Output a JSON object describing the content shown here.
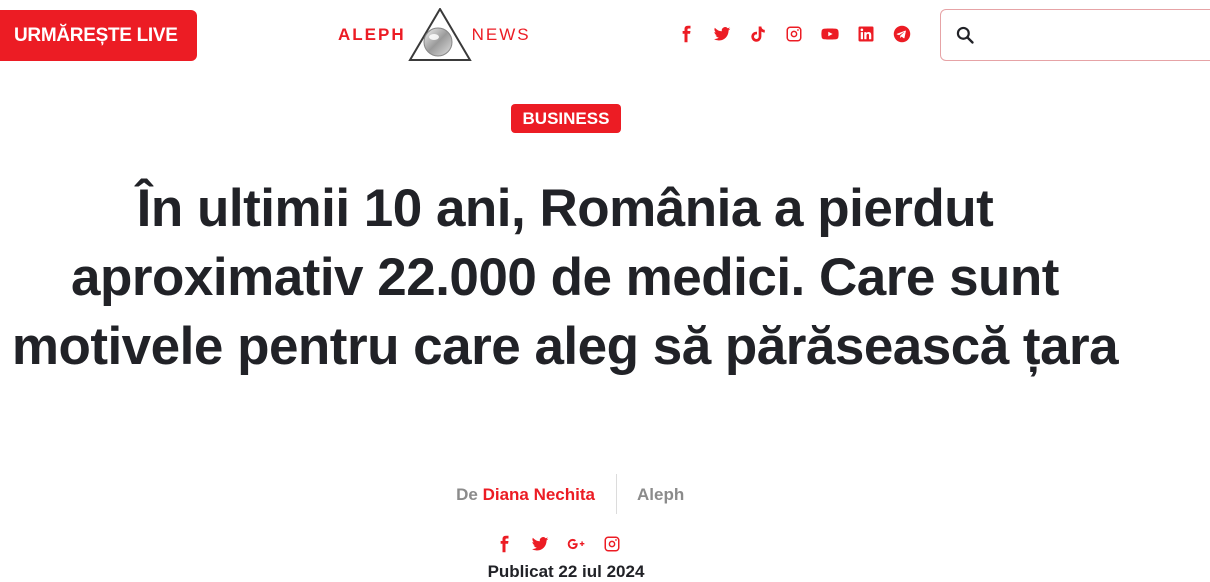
{
  "header": {
    "live_label": "URMĂREȘTE LIVE",
    "logo": {
      "left": "ALEPH",
      "right": "NEWS"
    },
    "social_icons": [
      "facebook-icon",
      "twitter-icon",
      "tiktok-icon",
      "instagram-icon",
      "youtube-icon",
      "linkedin-icon",
      "telegram-icon"
    ],
    "search": {
      "placeholder": "",
      "value": ""
    }
  },
  "article": {
    "category": "BUSINESS",
    "title": "În ultimii 10 ani, România a pierdut aproximativ 22.000 de medici. Care sunt motivele pentru care aleg să părăsească țara",
    "byline": {
      "prefix": "De",
      "author": "Diana Nechita",
      "source": "Aleph"
    },
    "share_icons": [
      "facebook-icon",
      "twitter-icon",
      "google-plus-icon",
      "instagram-icon"
    ],
    "published": "Publicat 22 iul 2024"
  },
  "colors": {
    "accent": "#ec1c24",
    "text": "#212227",
    "muted": "#8b8b8b"
  }
}
